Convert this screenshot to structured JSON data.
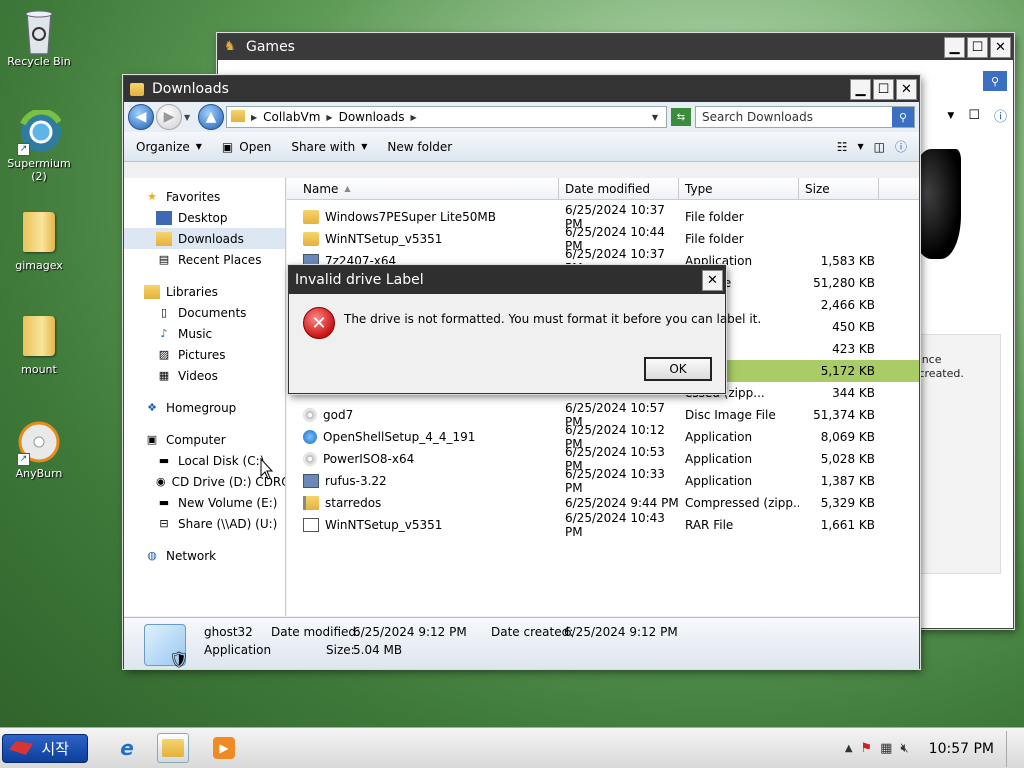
{
  "desktop": {
    "icons": [
      {
        "label": "Recycle Bin",
        "icon": "recycle-bin-icon"
      },
      {
        "label": "Supermium\n(2)",
        "icon": "supermium-icon"
      },
      {
        "label": "gimagex",
        "icon": "folder-icon"
      },
      {
        "label": "mount",
        "icon": "folder-icon"
      },
      {
        "label": "AnyBurn",
        "icon": "anyburn-icon"
      }
    ]
  },
  "games_window": {
    "title": "Games",
    "side_text": "nance\nn created.\n\ner"
  },
  "explorer": {
    "title": "Downloads",
    "address": {
      "crumbs": [
        "CollabVm",
        "Downloads"
      ]
    },
    "search_placeholder": "Search Downloads",
    "commands": {
      "organize": "Organize",
      "open": "Open",
      "share_with": "Share with",
      "new_folder": "New folder"
    },
    "nav": {
      "favorites": "Favorites",
      "desktop": "Desktop",
      "downloads": "Downloads",
      "recent_places": "Recent Places",
      "libraries": "Libraries",
      "documents": "Documents",
      "music": "Music",
      "pictures": "Pictures",
      "videos": "Videos",
      "homegroup": "Homegroup",
      "computer": "Computer",
      "local_disk": "Local Disk (C:)",
      "cd_drive": "CD Drive (D:) CDROM",
      "new_volume": "New Volume (E:)",
      "share": "Share (\\\\AD) (U:)",
      "network": "Network"
    },
    "columns": {
      "name": "Name",
      "date": "Date modified",
      "type": "Type",
      "size": "Size"
    },
    "files": [
      {
        "name": "Windows7PESuper Lite50MB",
        "date": "6/25/2024 10:37 PM",
        "type": "File folder",
        "size": "",
        "kind": "folder"
      },
      {
        "name": "WinNTSetup_v5351",
        "date": "6/25/2024 10:44 PM",
        "type": "File folder",
        "size": "",
        "kind": "folder"
      },
      {
        "name": "7z2407-x64",
        "date": "6/25/2024 10:37 PM",
        "type": "Application",
        "size": "1,583 KB",
        "kind": "app"
      },
      {
        "name": "",
        "date": "",
        "type": "age File",
        "size": "51,280 KB",
        "kind": "none"
      },
      {
        "name": "",
        "date": "",
        "type": "tion",
        "size": "2,466 KB",
        "kind": "none"
      },
      {
        "name": "",
        "date": "",
        "type": "tion",
        "size": "450 KB",
        "kind": "none"
      },
      {
        "name": "",
        "date": "",
        "type": "",
        "size": "423 KB",
        "kind": "none"
      },
      {
        "name": "",
        "date": "",
        "type": "tion",
        "size": "5,172 KB",
        "kind": "none",
        "highlight": true
      },
      {
        "name": "",
        "date": "",
        "type": "essed (zipp...",
        "size": "344 KB",
        "kind": "none"
      },
      {
        "name": "god7",
        "date": "6/25/2024 10:57 PM",
        "type": "Disc Image File",
        "size": "51,374 KB",
        "kind": "disc"
      },
      {
        "name": "OpenShellSetup_4_4_191",
        "date": "6/25/2024 10:12 PM",
        "type": "Application",
        "size": "8,069 KB",
        "kind": "shell"
      },
      {
        "name": "PowerISO8-x64",
        "date": "6/25/2024 10:53 PM",
        "type": "Application",
        "size": "5,028 KB",
        "kind": "disc"
      },
      {
        "name": "rufus-3.22",
        "date": "6/25/2024 10:33 PM",
        "type": "Application",
        "size": "1,387 KB",
        "kind": "app"
      },
      {
        "name": "starredos",
        "date": "6/25/2024 9:44 PM",
        "type": "Compressed (zipp...",
        "size": "5,329 KB",
        "kind": "zip"
      },
      {
        "name": "WinNTSetup_v5351",
        "date": "6/25/2024 10:43 PM",
        "type": "RAR File",
        "size": "1,661 KB",
        "kind": "rar"
      }
    ],
    "details": {
      "name": "ghost32",
      "kind": "Application",
      "modified_label": "Date modified:",
      "modified": "6/25/2024 9:12 PM",
      "created_label": "Date created:",
      "created": "6/25/2024 9:12 PM",
      "size_label": "Size:",
      "size": "5.04 MB"
    }
  },
  "dialog": {
    "title": "Invalid drive Label",
    "message": "The drive is not formatted.  You must format it before you can label it.",
    "ok": "OK"
  },
  "taskbar": {
    "start": "시작",
    "time": "10:57 PM"
  }
}
